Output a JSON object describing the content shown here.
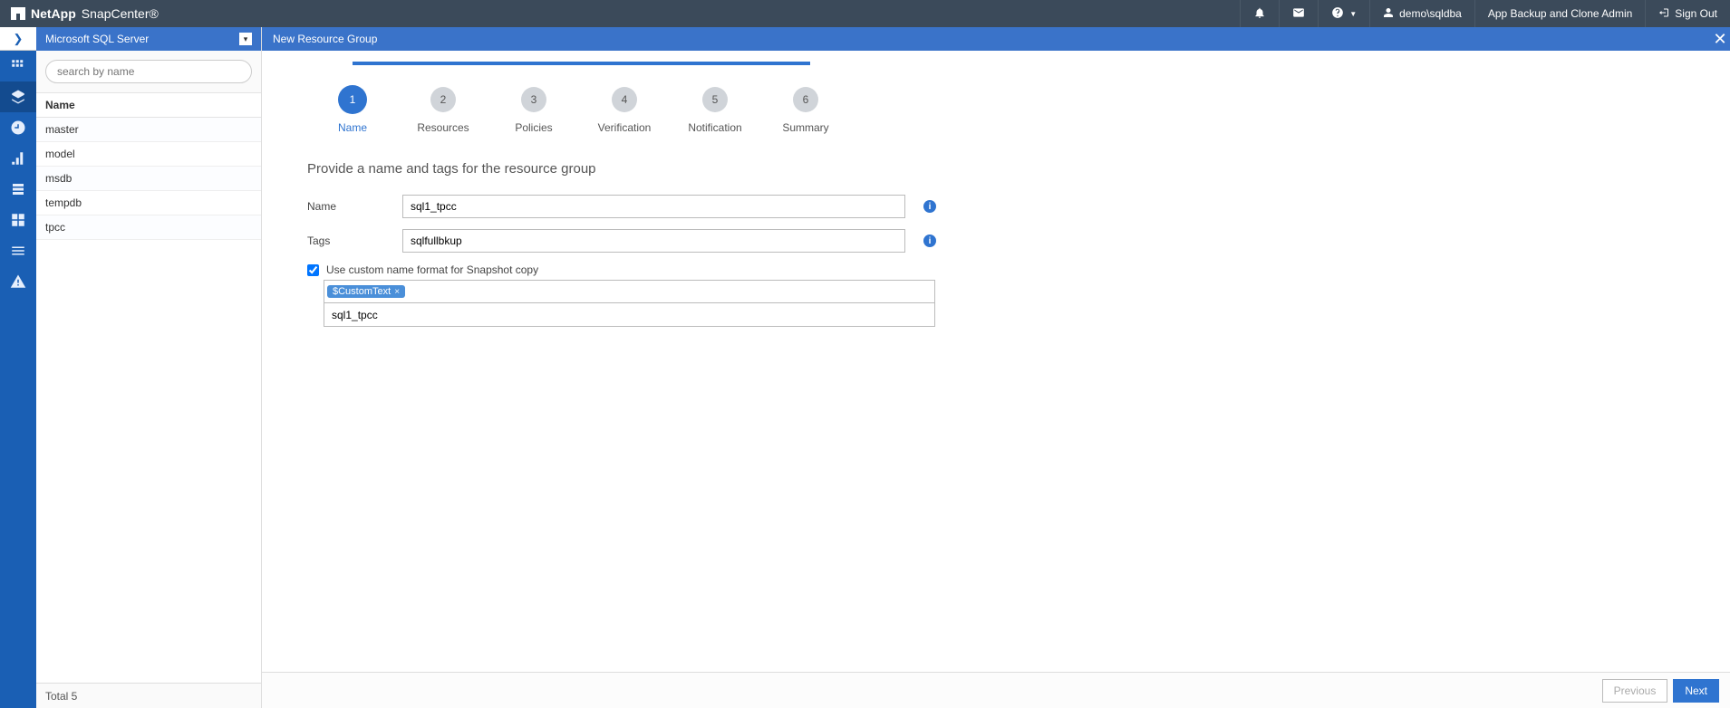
{
  "brand": {
    "company": "NetApp",
    "product": "SnapCenter®"
  },
  "topbar": {
    "user": "demo\\sqldba",
    "role": "App Backup and Clone Admin",
    "signout": "Sign Out"
  },
  "sidebar": {
    "resource_type": "Microsoft SQL Server",
    "search_placeholder": "search by name",
    "column": "Name",
    "items": [
      "master",
      "model",
      "msdb",
      "tempdb",
      "tpcc"
    ],
    "footer": "Total 5"
  },
  "content": {
    "title": "New Resource Group",
    "steps": [
      "Name",
      "Resources",
      "Policies",
      "Verification",
      "Notification",
      "Summary"
    ],
    "active_step": 0,
    "form_title": "Provide a name and tags for the resource group",
    "labels": {
      "name": "Name",
      "tags": "Tags",
      "custom_format": "Use custom name format for Snapshot copy"
    },
    "values": {
      "name": "sql1_tpcc",
      "tags": "sqlfullbkup",
      "custom_checked": true,
      "token": "$CustomText",
      "custom_value": "sql1_tpcc"
    },
    "buttons": {
      "prev": "Previous",
      "next": "Next"
    }
  }
}
